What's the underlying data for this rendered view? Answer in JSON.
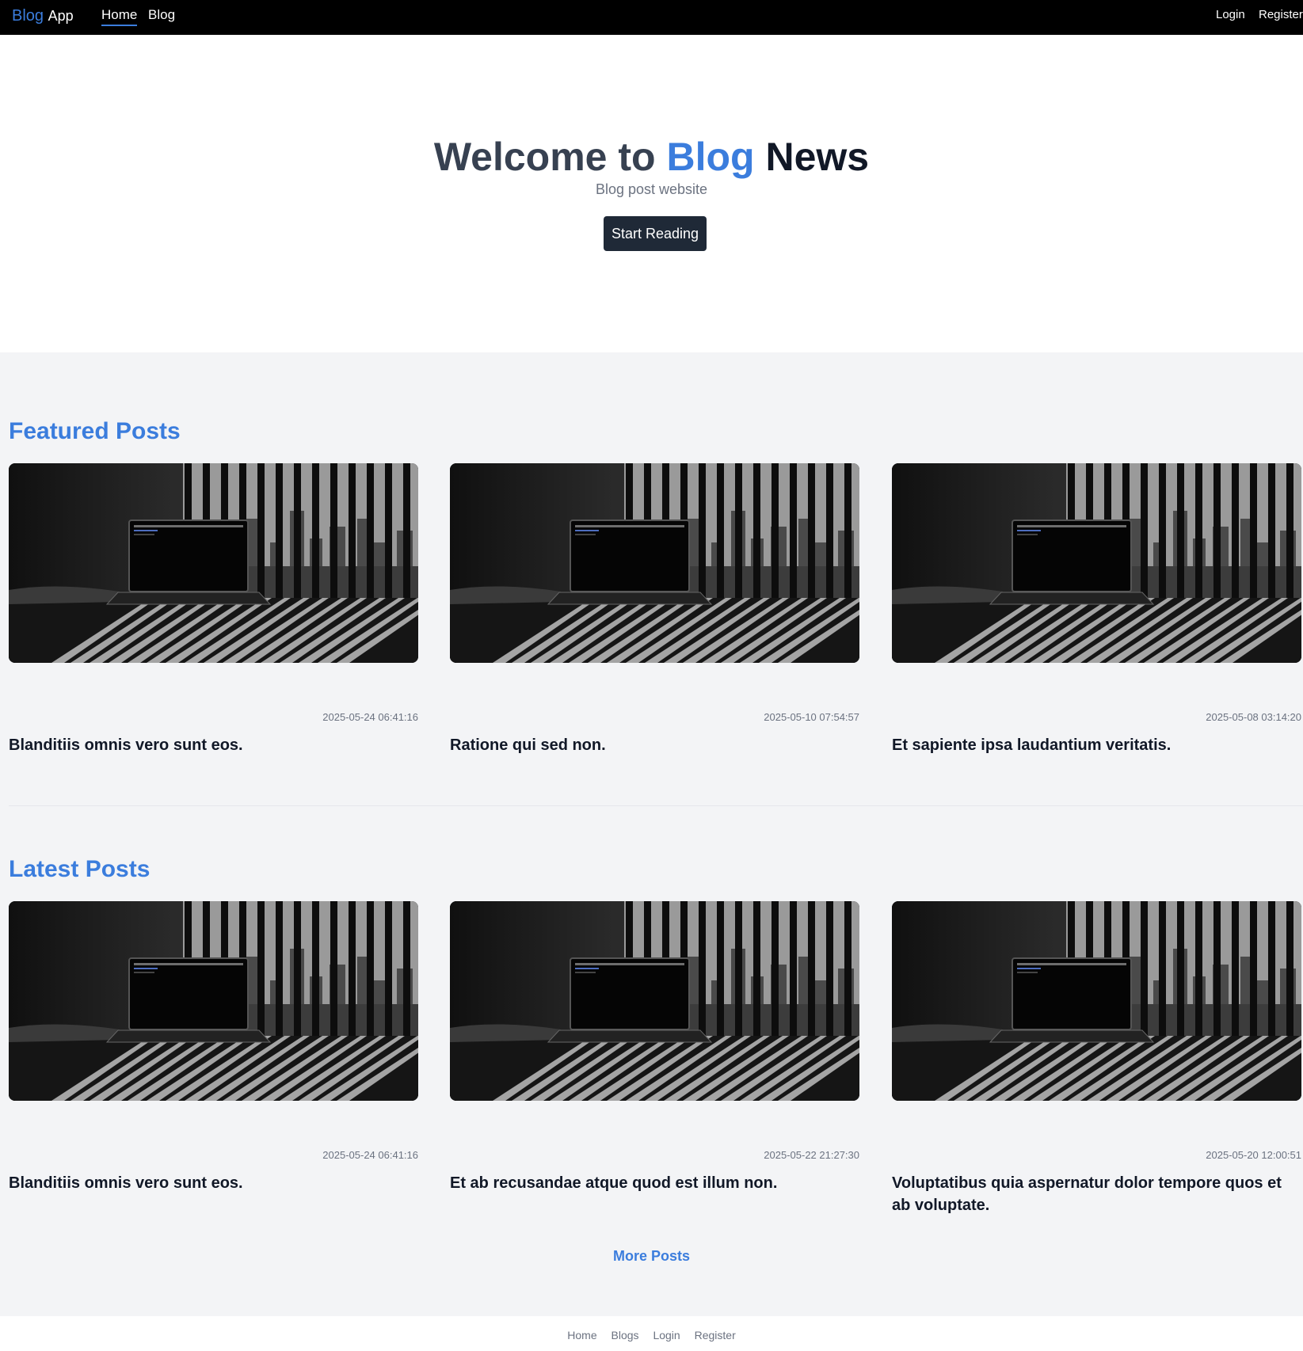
{
  "brand": {
    "part1": "Blog",
    "part2": "App"
  },
  "nav": {
    "home": "Home",
    "blog": "Blog",
    "login": "Login",
    "register": "Register"
  },
  "hero": {
    "title_a": "Welcome to ",
    "title_b": "Blog",
    "title_c": " News",
    "subtitle": "Blog post website",
    "button": "Start Reading"
  },
  "featured": {
    "title": "Featured Posts",
    "posts": [
      {
        "date": "2025-05-24 06:41:16",
        "title": "Blanditiis omnis vero sunt eos."
      },
      {
        "date": "2025-05-10 07:54:57",
        "title": "Ratione qui sed non."
      },
      {
        "date": "2025-05-08 03:14:20",
        "title": "Et sapiente ipsa laudantium veritatis."
      }
    ]
  },
  "latest": {
    "title": "Latest Posts",
    "posts": [
      {
        "date": "2025-05-24 06:41:16",
        "title": "Blanditiis omnis vero sunt eos."
      },
      {
        "date": "2025-05-22 21:27:30",
        "title": "Et ab recusandae atque quod est illum non."
      },
      {
        "date": "2025-05-20 12:00:51",
        "title": "Voluptatibus quia aspernatur dolor tempore quos et ab voluptate."
      }
    ]
  },
  "more_posts": "More Posts",
  "footer": {
    "home": "Home",
    "blogs": "Blogs",
    "login": "Login",
    "register": "Register"
  }
}
